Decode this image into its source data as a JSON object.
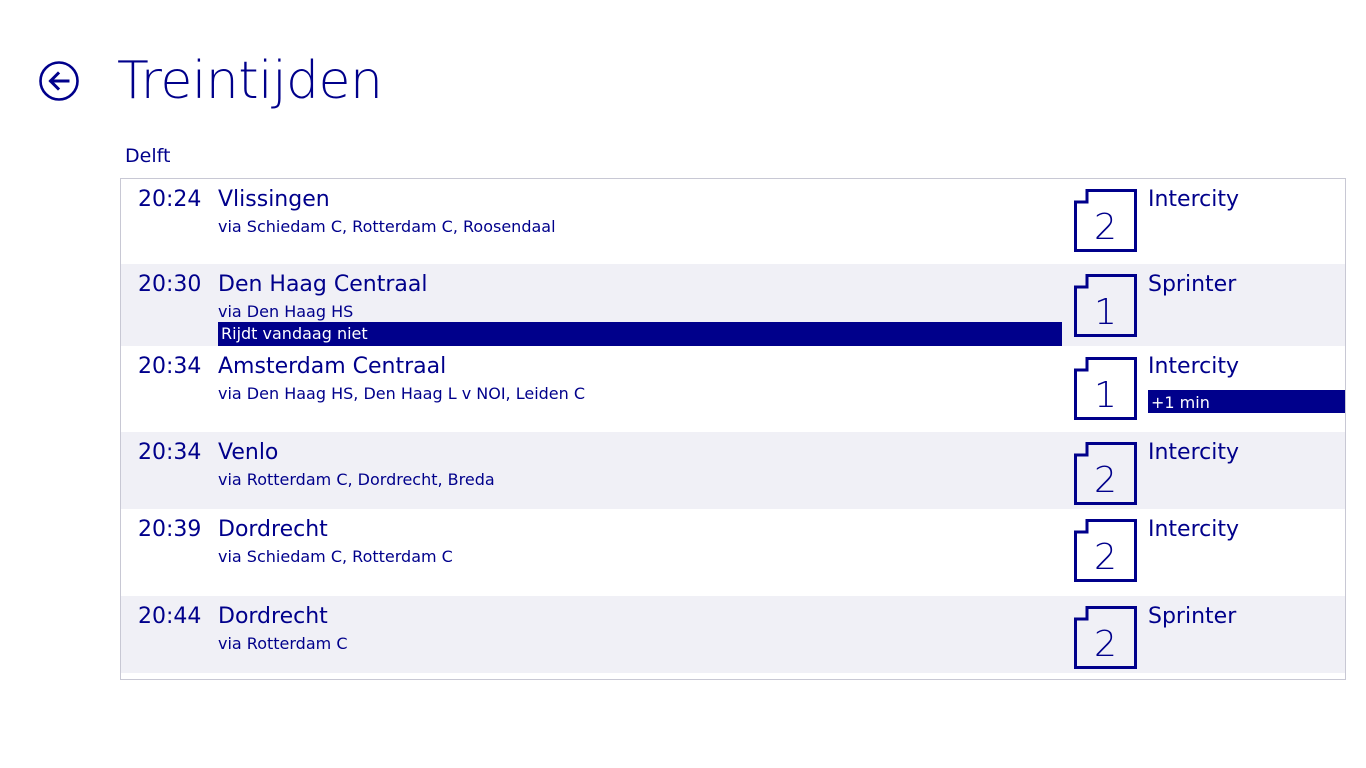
{
  "header": {
    "title": "Treintijden",
    "back_icon": "back-arrow-icon"
  },
  "station": "Delft",
  "departures": [
    {
      "time": "20:24",
      "destination": "Vlissingen",
      "via": "via Schiedam C, Rotterdam C, Roosendaal",
      "platform": "2",
      "train_type": "Intercity"
    },
    {
      "time": "20:30",
      "destination": "Den Haag Centraal",
      "via": "via Den Haag HS",
      "notice": "Rijdt vandaag niet",
      "platform": "1",
      "train_type": "Sprinter"
    },
    {
      "time": "20:34",
      "destination": "Amsterdam Centraal",
      "via": "via Den Haag HS, Den Haag L v NOI, Leiden C",
      "platform": "1",
      "train_type": "Intercity",
      "delay": "+1 min"
    },
    {
      "time": "20:34",
      "destination": "Venlo",
      "via": "via Rotterdam C, Dordrecht, Breda",
      "platform": "2",
      "train_type": "Intercity"
    },
    {
      "time": "20:39",
      "destination": "Dordrecht",
      "via": "via Schiedam C, Rotterdam C",
      "platform": "2",
      "train_type": "Intercity"
    },
    {
      "time": "20:44",
      "destination": "Dordrecht",
      "via": "via Rotterdam C",
      "platform": "2",
      "train_type": "Sprinter"
    }
  ],
  "colors": {
    "accent": "#00008b",
    "row_alt": "#f0f0f6",
    "background": "#ffffff"
  }
}
